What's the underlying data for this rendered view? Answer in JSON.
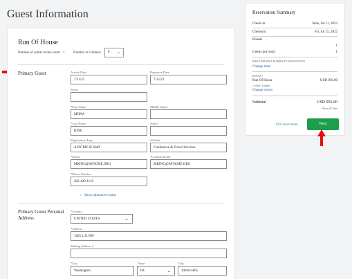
{
  "page": {
    "title": "Guest Information"
  },
  "form": {
    "room_title": "Run Of House",
    "adults_label": "Number of adults in this room:",
    "adults_value": "1",
    "children_label": "Number of children:",
    "children_value": "0",
    "primary_guest_label": "Primary Guest",
    "address_section_label": "Primary Guest Personal Address",
    "show_alt_name": "Show alternative name",
    "fields": {
      "arrival": {
        "label": "Arrival Date",
        "value": "7/11/22"
      },
      "departure": {
        "label": "Departure Date",
        "value": "7/15/22"
      },
      "prefix": {
        "label": "Prefix",
        "value": ""
      },
      "first_name": {
        "label": "*First Name",
        "value": "MONA"
      },
      "middle_initial": {
        "label": "Middle Initial",
        "value": ""
      },
      "last_name": {
        "label": "*Last Name",
        "value": "KING"
      },
      "suffix": {
        "label": "Suffix",
        "value": ""
      },
      "registration_type": {
        "label": "Registration Type",
        "value": "AFSCME IU Staff"
      },
      "affiliate": {
        "label": "Affiliate",
        "value": "Conference & Travel Services"
      },
      "email": {
        "label": "*Email",
        "value": "MKING@AFSCME.ORG"
      },
      "confirm_email": {
        "label": "*Confirm Email",
        "value": "MKING@AFSCME.ORG"
      },
      "phone": {
        "label": "*Phone Number",
        "value": "202-429-1116"
      },
      "country": {
        "label": "*Country",
        "value": "UNITED STATES"
      },
      "address": {
        "label": "*Address",
        "value": "1625 L St NW"
      },
      "mailing_address2": {
        "label": "Mailing Address 2",
        "value": ""
      },
      "city": {
        "label": "*City",
        "value": "Washington"
      },
      "state": {
        "label": "*State",
        "value": "DC"
      },
      "zip": {
        "label": "*Zip",
        "value": "20036-5665"
      }
    }
  },
  "summary": {
    "title": "Reservation Summary",
    "checkin_label": "Check-in",
    "checkin_value": "Mon, Jul 11, 2022",
    "checkout_label": "Checkout",
    "checkout_value": "Fri, Jul 15, 2022",
    "rooms_label": "Rooms",
    "rooms_value": "1",
    "guests_label": "Guests per room",
    "guests_value": "1",
    "hotel_name": "PHILADELPHIA MARRIOTT DOWNTOWN",
    "change_hotel": "Change hotel",
    "room_index": "ROOM 1",
    "room_name": "Run Of House",
    "room_price": "USD 956.00",
    "room_detail": "1 adult, 4 nights",
    "change_rooms": "Change rooms",
    "subtotal_label": "Subtotal",
    "subtotal_value": "USD 956.00",
    "taxes_note": "+Taxes & Fees",
    "edit_label": "Edit reservation",
    "next_label": "Next"
  },
  "colors": {
    "accent_green": "#1e9e4a",
    "link_blue": "#1a5fb4",
    "arrow_red": "#e01010"
  },
  "icons": {
    "dropdown": "chevron-down-icon",
    "pointer": "red-arrow-icon"
  }
}
